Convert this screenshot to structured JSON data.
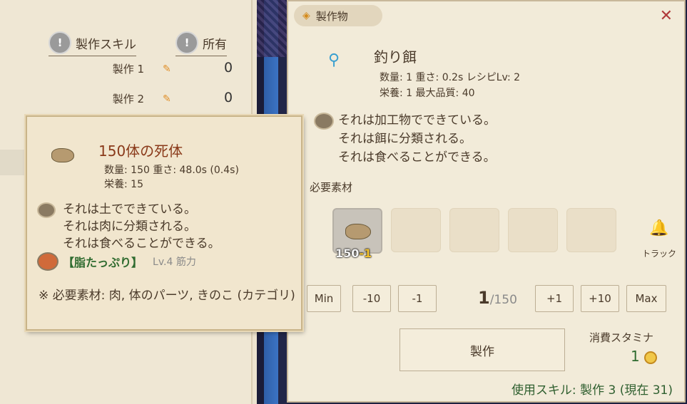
{
  "skills_panel": {
    "col_skill": "製作スキル",
    "col_owned": "所有",
    "rows": [
      {
        "name": "製作 1",
        "value": "0"
      },
      {
        "name": "製作 2",
        "value": "0"
      }
    ]
  },
  "craft": {
    "title": "製作物",
    "item_name": "釣り餌",
    "stats_line1": "数量: 1  重さ: 0.2s  レシピLv: 2",
    "stats_line2": "栄養: 1  最大品質: 40",
    "desc": [
      "それは加工物でできている。",
      "それは餌に分類される。",
      "それは食べることができる。"
    ],
    "required_label": "必要素材",
    "slot_qty": "150",
    "slot_delta": "-1",
    "track_label": "トラック",
    "buttons": {
      "min": "Min",
      "m10": "-10",
      "m1": "-1",
      "p1": "+1",
      "p10": "+10",
      "max": "Max"
    },
    "qty_current": "1",
    "qty_max": "/150",
    "craft_button": "製作",
    "stamina_label": "消費スタミナ",
    "stamina_value": "1",
    "skill_used": "使用スキル: 製作 3 (現在 31)"
  },
  "tooltip": {
    "name": "150体の死体",
    "stats_line1": "数量: 150  重さ: 48.0s (0.4s)",
    "stats_line2": "栄養: 15",
    "desc": [
      "それは土でできている。",
      "それは肉に分類される。",
      "それは食べることができる。"
    ],
    "trait_name": "【脂たっぷり】",
    "trait_level": "Lv.4 筋力",
    "note": "※ 必要素材: 肉, 体のパーツ, きのこ (カテゴリ)"
  }
}
